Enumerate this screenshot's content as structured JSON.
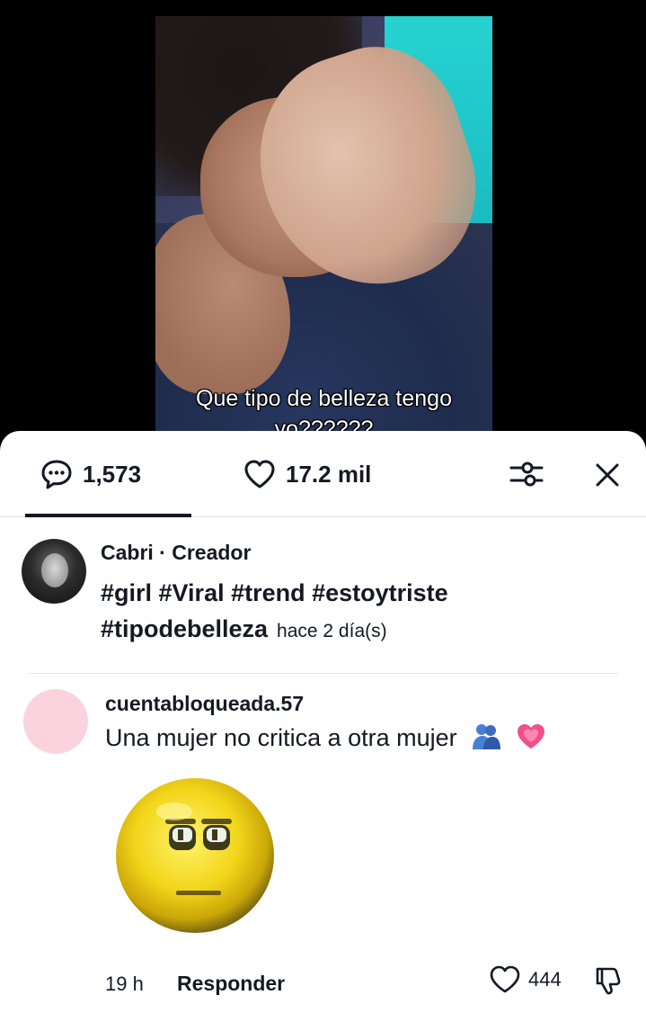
{
  "video": {
    "caption": "Que tipo de belleza tengo\nyo??????"
  },
  "tabs": {
    "comments_count": "1,573",
    "likes_count": "17.2 mil"
  },
  "creator": {
    "name": "Cabri",
    "role": " · Creador",
    "text": "#girl #Viral #trend #estoytriste #tipodebelleza",
    "time": "hace 2 día(s)"
  },
  "comment": {
    "username": "cuentabloqueada.57",
    "text": "Una mujer no critica a otra mujer",
    "emojis": [
      "people-hugging",
      "growing-heart"
    ],
    "time": "19 h",
    "reply_label": "Responder",
    "likes": "444"
  },
  "colors": {
    "text": "#161823",
    "comment_avatar": "#fbd3de",
    "divider": "#e6e6e6"
  }
}
